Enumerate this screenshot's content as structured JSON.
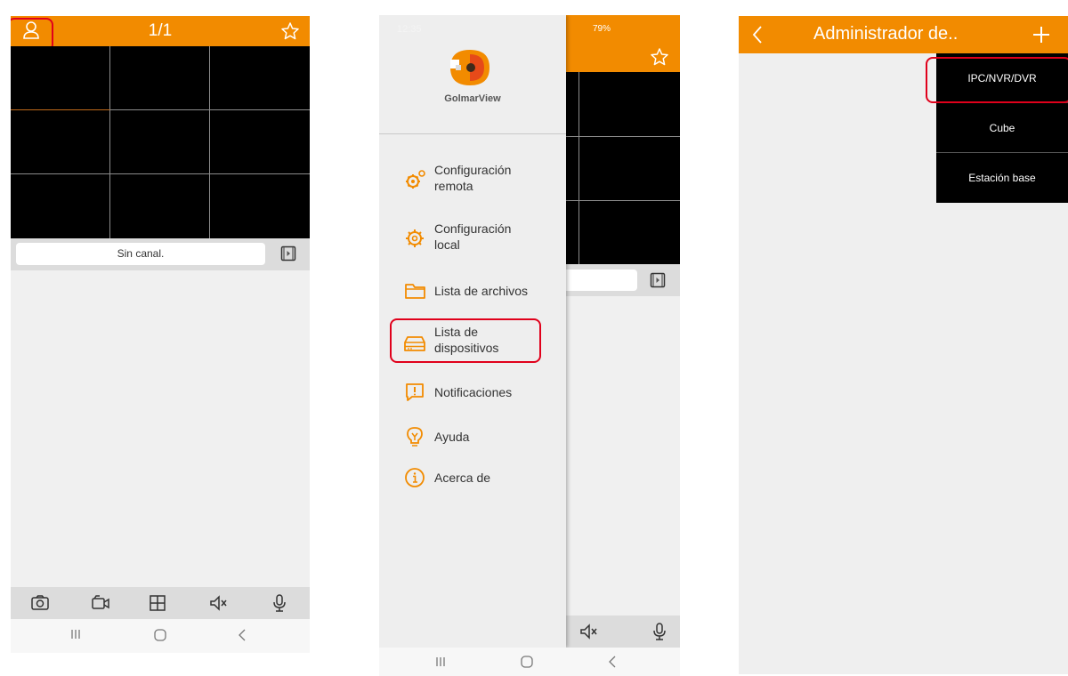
{
  "colors": {
    "accent": "#f28b00",
    "highlight": "#e0001b",
    "video_bg": "#000000"
  },
  "screen1": {
    "title": "1/1",
    "channel_text": "Sin canal.",
    "header_icons": [
      "user-icon",
      "star-icon"
    ],
    "toolbar_icons": [
      "camera-icon",
      "video-record-icon",
      "grid-icon",
      "mute-icon",
      "microphone-icon"
    ],
    "nav_icons": [
      "recents-icon",
      "home-icon",
      "back-icon"
    ]
  },
  "screen2": {
    "status": {
      "time": "12:35",
      "battery": "79%"
    },
    "logo_text": "GolmarView",
    "menu": [
      {
        "line1": "Configuración",
        "line2": "remota",
        "icon": "remote-gear-icon"
      },
      {
        "line1": "Configuración",
        "line2": "local",
        "icon": "local-gear-icon"
      },
      {
        "line1": "Lista de archivos",
        "line2": "",
        "icon": "folder-icon"
      },
      {
        "line1": "Lista de",
        "line2": "dispositivos",
        "icon": "device-list-icon"
      },
      {
        "line1": "Notificaciones",
        "line2": "",
        "icon": "notification-icon"
      },
      {
        "line1": "Ayuda",
        "line2": "",
        "icon": "help-bulb-icon"
      },
      {
        "line1": "Acerca de",
        "line2": "",
        "icon": "info-icon"
      }
    ]
  },
  "screen3": {
    "title": "Administrador de..",
    "dropdown": [
      "IPC/NVR/DVR",
      "Cube",
      "Estación base"
    ]
  }
}
